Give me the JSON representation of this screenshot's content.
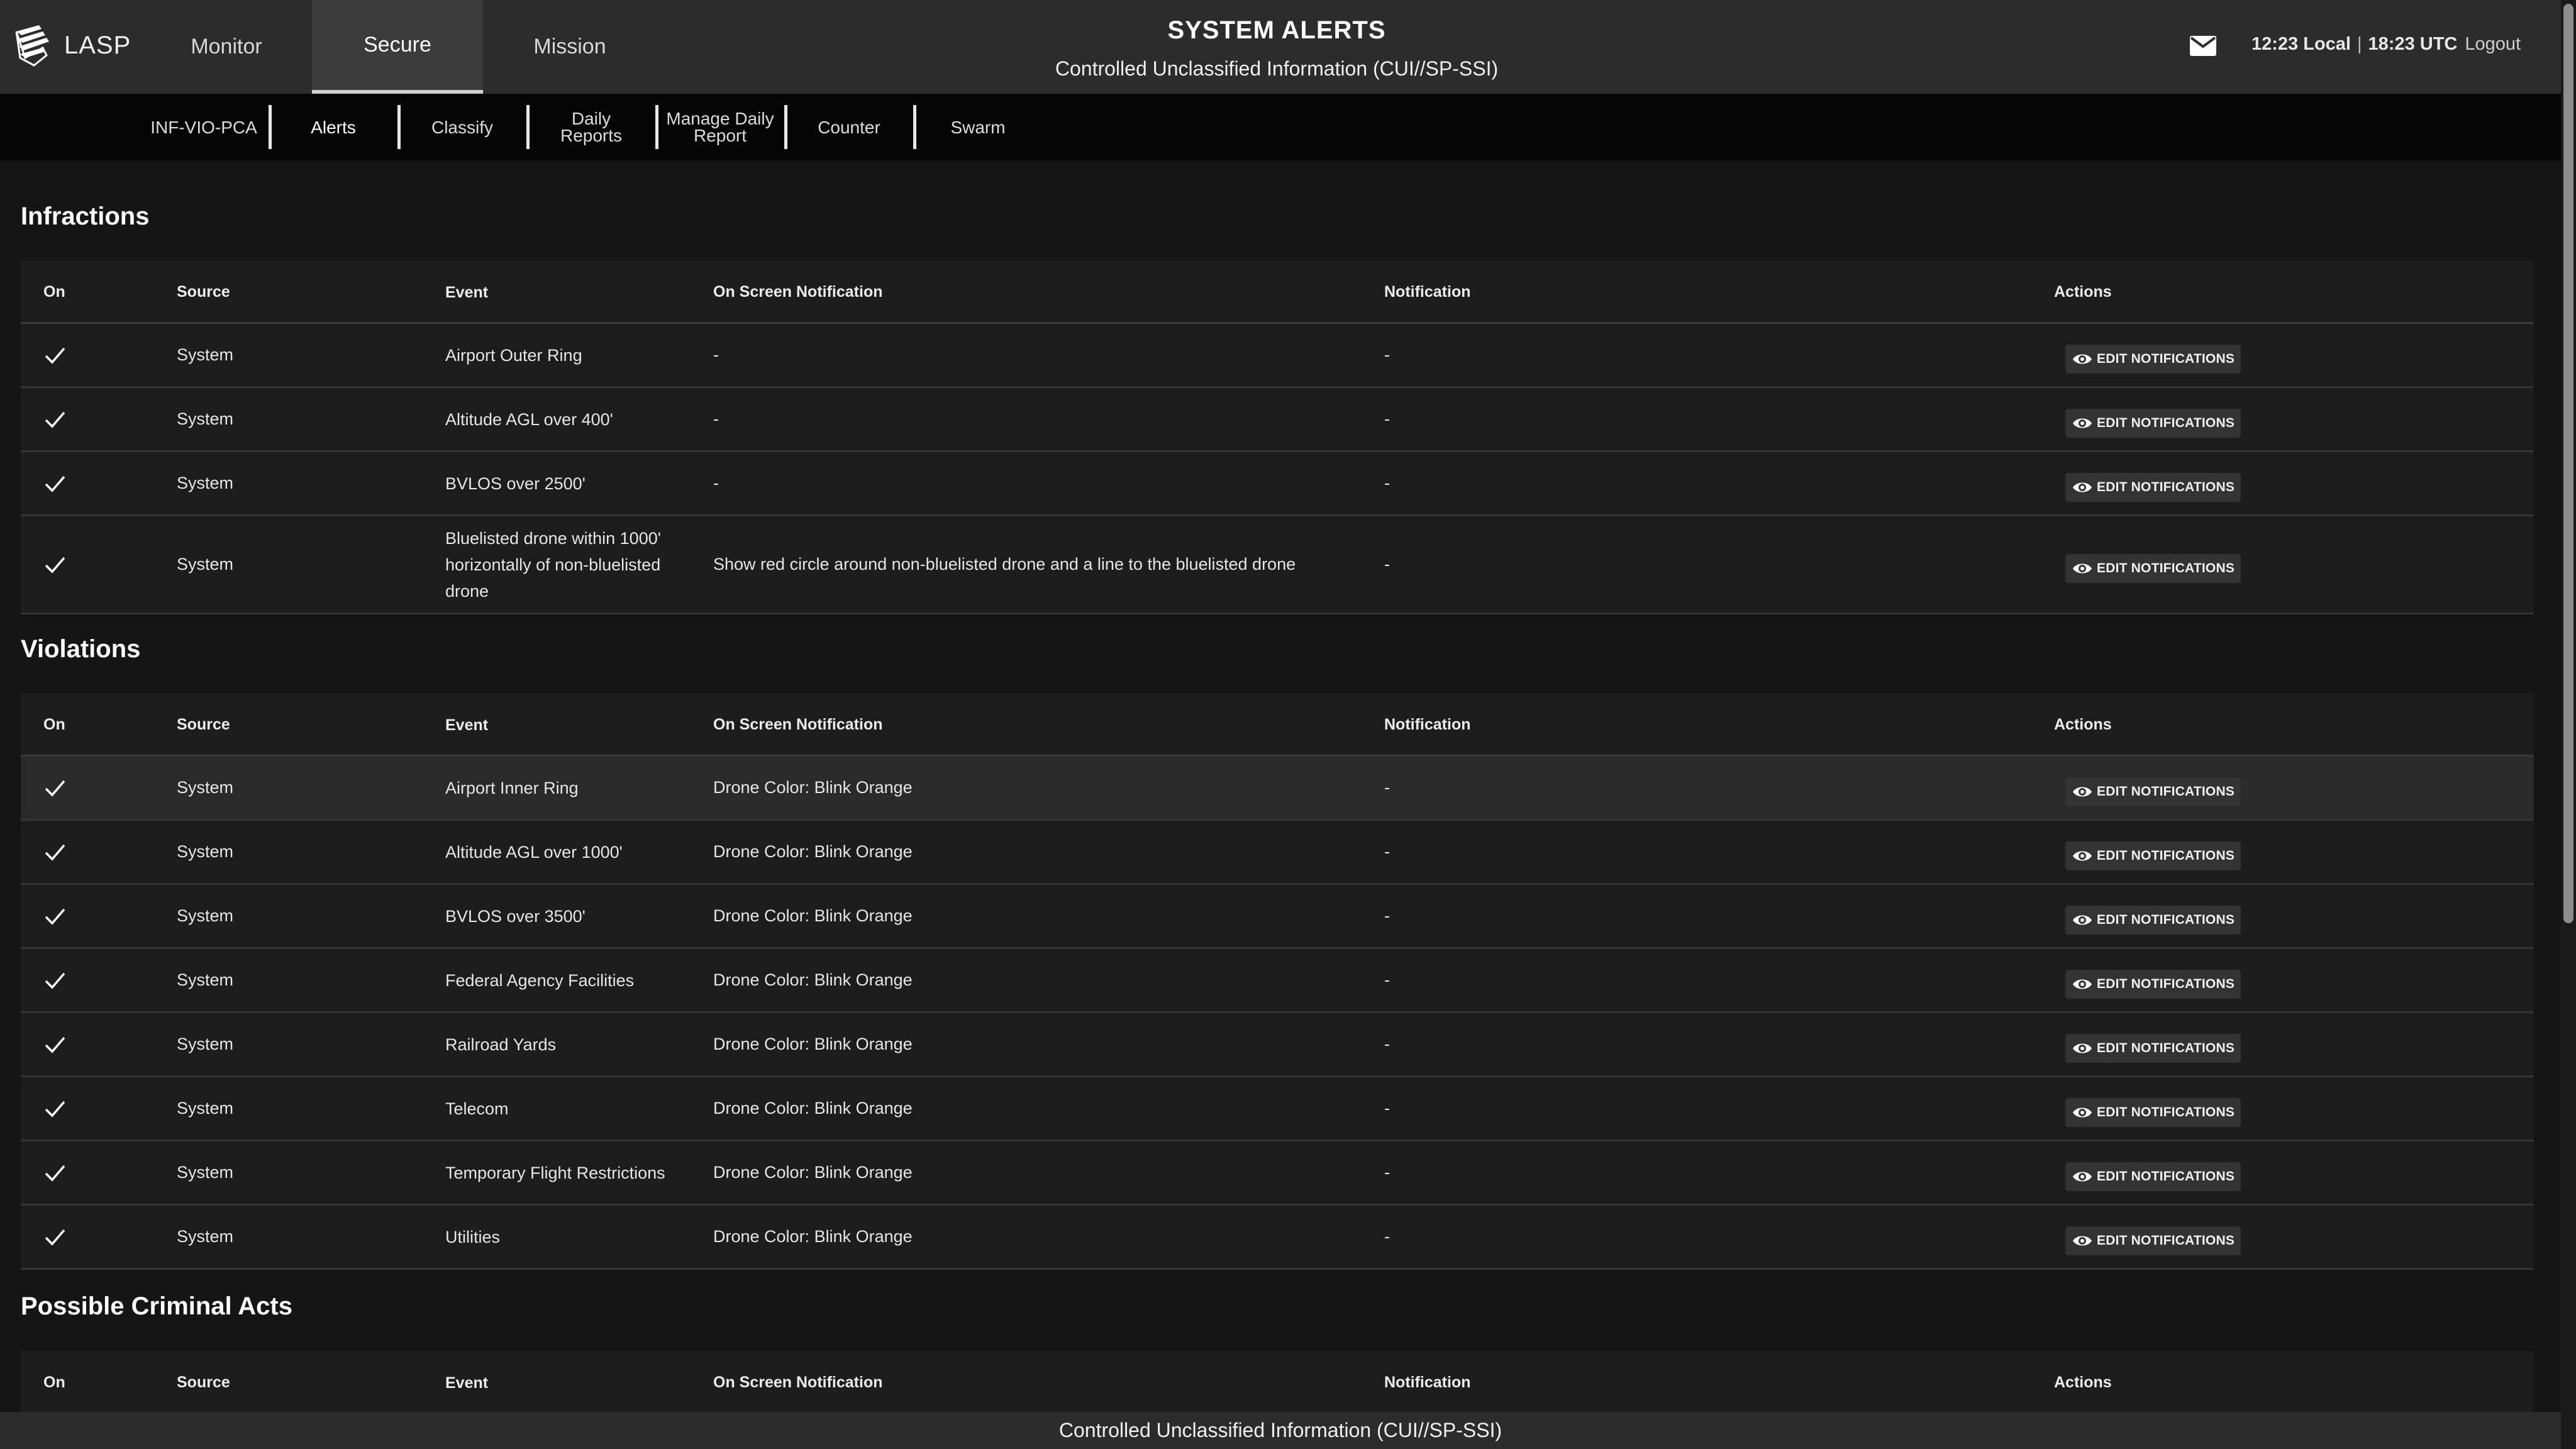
{
  "app": {
    "logo_text": "LASP"
  },
  "header": {
    "tabs": [
      {
        "label": "Monitor"
      },
      {
        "label": "Secure"
      },
      {
        "label": "Mission"
      }
    ],
    "title": "SYSTEM ALERTS",
    "subtitle": "Controlled Unclassified Information (CUI//SP-SSI)",
    "local_time": "12:23 Local",
    "separator": "|",
    "utc_time": "18:23 UTC",
    "logout": "Logout"
  },
  "subnav": {
    "items": [
      {
        "label": "INF-VIO-PCA"
      },
      {
        "label": "Alerts"
      },
      {
        "label": "Classify"
      },
      {
        "label": "Daily Reports"
      },
      {
        "label": "Manage Daily Report"
      },
      {
        "label": "Counter"
      },
      {
        "label": "Swarm"
      }
    ]
  },
  "columns": {
    "on": "On",
    "source": "Source",
    "event": "Event",
    "on_screen": "On Screen Notification",
    "notification": "Notification",
    "actions": "Actions"
  },
  "edit_label": "EDIT NOTIFICATIONS",
  "sections": {
    "infractions": {
      "title": "Infractions",
      "rows": [
        {
          "source": "System",
          "event": "Airport Outer Ring",
          "on_screen": "-",
          "notification": "-"
        },
        {
          "source": "System",
          "event": "Altitude AGL over 400'",
          "on_screen": "-",
          "notification": "-"
        },
        {
          "source": "System",
          "event": "BVLOS over 2500'",
          "on_screen": "-",
          "notification": "-"
        },
        {
          "source": "System",
          "event": "Bluelisted drone within 1000' horizontally of non-bluelisted drone",
          "on_screen": "Show red circle around non-bluelisted drone and a line to the bluelisted drone",
          "notification": "-"
        }
      ]
    },
    "violations": {
      "title": "Violations",
      "rows": [
        {
          "source": "System",
          "event": "Airport Inner Ring",
          "on_screen": "Drone Color: Blink Orange",
          "notification": "-"
        },
        {
          "source": "System",
          "event": "Altitude AGL over 1000'",
          "on_screen": "Drone Color: Blink Orange",
          "notification": "-"
        },
        {
          "source": "System",
          "event": "BVLOS over 3500'",
          "on_screen": "Drone Color: Blink Orange",
          "notification": "-"
        },
        {
          "source": "System",
          "event": "Federal Agency Facilities",
          "on_screen": "Drone Color: Blink Orange",
          "notification": "-"
        },
        {
          "source": "System",
          "event": "Railroad Yards",
          "on_screen": "Drone Color: Blink Orange",
          "notification": "-"
        },
        {
          "source": "System",
          "event": "Telecom",
          "on_screen": "Drone Color: Blink Orange",
          "notification": "-"
        },
        {
          "source": "System",
          "event": "Temporary Flight Restrictions",
          "on_screen": "Drone Color: Blink Orange",
          "notification": "-"
        },
        {
          "source": "System",
          "event": "Utilities",
          "on_screen": "Drone Color: Blink Orange",
          "notification": "-"
        }
      ]
    },
    "criminal": {
      "title": "Possible Criminal Acts"
    }
  },
  "footer": {
    "text": "Controlled Unclassified Information (CUI//SP-SSI)"
  }
}
